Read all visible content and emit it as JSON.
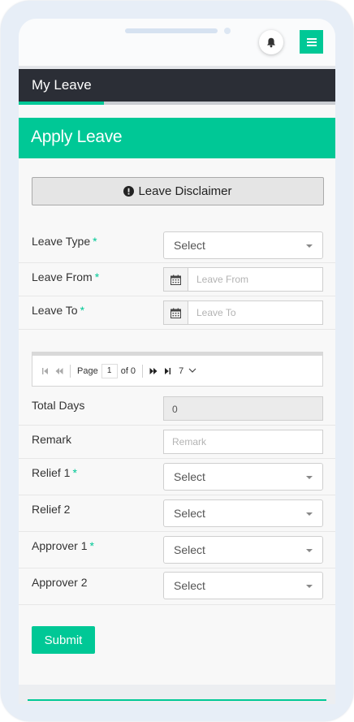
{
  "header": {
    "page_title": "My Leave",
    "progress_percent": 27
  },
  "form": {
    "title": "Apply Leave",
    "disclaimer_label": "Leave Disclaimer",
    "leave_type": {
      "label": "Leave Type",
      "required": "*",
      "value": "Select"
    },
    "leave_from": {
      "label": "Leave From",
      "required": "*",
      "placeholder": "Leave From"
    },
    "leave_to": {
      "label": "Leave To",
      "required": "*",
      "placeholder": "Leave To"
    },
    "pager": {
      "page_label": "Page",
      "page_value": "1",
      "of_label": "of 0",
      "page_size": "7"
    },
    "total_days": {
      "label": "Total Days",
      "value": "0"
    },
    "remark": {
      "label": "Remark",
      "placeholder": "Remark"
    },
    "relief1": {
      "label": "Relief 1",
      "required": "*",
      "value": "Select"
    },
    "relief2": {
      "label": "Relief 2",
      "value": "Select"
    },
    "approver1": {
      "label": "Approver 1",
      "required": "*",
      "value": "Select"
    },
    "approver2": {
      "label": "Approver 2",
      "value": "Select"
    },
    "submit_label": "Submit"
  },
  "colors": {
    "accent": "#00c896",
    "header_bg": "#2b2e36"
  }
}
